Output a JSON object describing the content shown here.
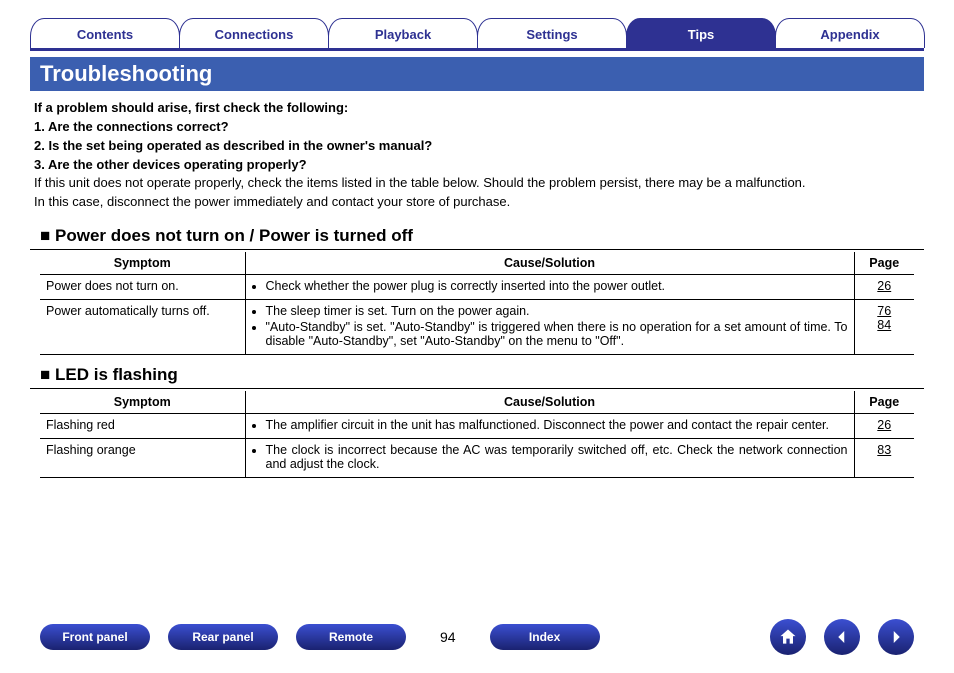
{
  "tabs": [
    {
      "label": "Contents",
      "active": false
    },
    {
      "label": "Connections",
      "active": false
    },
    {
      "label": "Playback",
      "active": false
    },
    {
      "label": "Settings",
      "active": false
    },
    {
      "label": "Tips",
      "active": true
    },
    {
      "label": "Appendix",
      "active": false
    }
  ],
  "section_title": "Troubleshooting",
  "intro": {
    "bold_lines": [
      "If a problem should arise, first check the following:",
      "1. Are the connections correct?",
      "2. Is the set being operated as described in the owner's manual?",
      "3. Are the other devices operating properly?"
    ],
    "body_lines": [
      "If this unit does not operate properly, check the items listed in the table below. Should the problem persist, there may be a malfunction.",
      "In this case, disconnect the power immediately and contact your store of purchase."
    ]
  },
  "headers": {
    "symptom": "Symptom",
    "cause": "Cause/Solution",
    "page": "Page"
  },
  "sec1": {
    "title": "Power does not turn on / Power is turned off",
    "rows": [
      {
        "symptom": "Power does not turn on.",
        "causes": [
          "Check whether the power plug is correctly inserted into the power outlet."
        ],
        "pages": [
          "26"
        ]
      },
      {
        "symptom": "Power automatically turns off.",
        "causes": [
          "The sleep timer is set. Turn on the power again.",
          "\"Auto-Standby\" is set. \"Auto-Standby\" is triggered when there is no operation for a set amount of time. To disable \"Auto-Standby\", set \"Auto-Standby\" on the menu to \"Off\"."
        ],
        "pages": [
          "76",
          "84"
        ]
      }
    ]
  },
  "sec2": {
    "title": "LED is flashing",
    "rows": [
      {
        "symptom": "Flashing red",
        "causes": [
          "The amplifier circuit in the unit has malfunctioned. Disconnect the power and contact the repair center."
        ],
        "pages": [
          "26"
        ]
      },
      {
        "symptom": "Flashing orange",
        "causes": [
          "The clock is incorrect because the AC was temporarily switched off, etc. Check the network connection and adjust the clock."
        ],
        "pages": [
          "83"
        ]
      }
    ]
  },
  "bottom": {
    "front": "Front panel",
    "rear": "Rear panel",
    "remote": "Remote",
    "index": "Index",
    "pagenum": "94"
  }
}
